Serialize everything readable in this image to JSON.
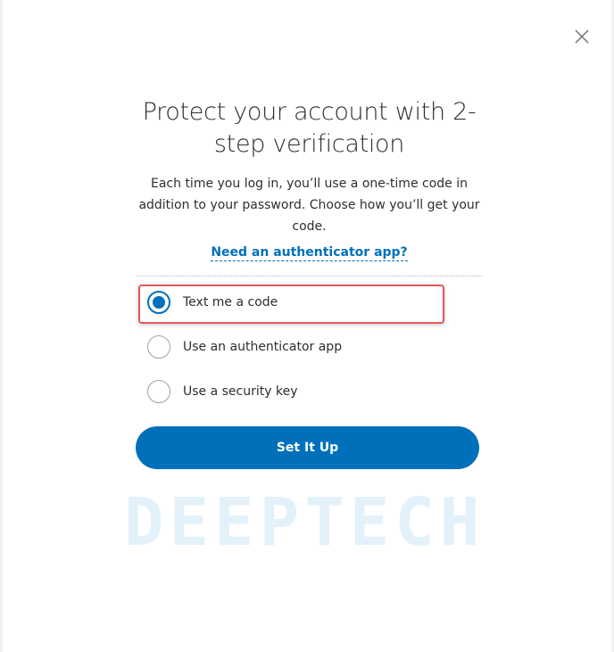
{
  "dialog": {
    "title": "Protect your account with 2-step verification",
    "description": "Each time you log in, you’ll use a one-time code in addition to your password. Choose how you’ll get your code.",
    "help_link": "Need an authenticator app?",
    "options": [
      {
        "label": "Text me a code",
        "selected": true
      },
      {
        "label": "Use an authenticator app",
        "selected": false
      },
      {
        "label": "Use a security key",
        "selected": false
      }
    ],
    "submit_label": "Set It Up"
  },
  "watermark": "DEEPTECH",
  "icons": {
    "close": "close-icon"
  },
  "colors": {
    "accent": "#0070ba",
    "highlight": "#e35a5a",
    "watermark": "#e3f1fb"
  }
}
